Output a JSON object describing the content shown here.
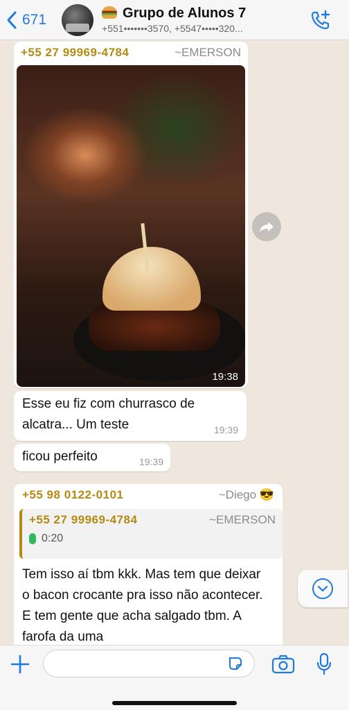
{
  "header": {
    "back_count": "671",
    "title": "Grupo de Alunos 7",
    "subtitle": "+551•••••••3570, +5547•••••320..."
  },
  "messages": {
    "m1": {
      "sender_phone": "+55 27 99969-4784",
      "sender_name": "~EMERSON",
      "photo_time": "19:38"
    },
    "m2": {
      "text": "Esse eu fiz com churrasco de alcatra...  Um teste",
      "time": "19:39"
    },
    "m3": {
      "text": "ficou perfeito",
      "time": "19:39"
    },
    "m4": {
      "sender_phone": "+55 98 0122-0101",
      "sender_name": "~Diego 😎",
      "quote_phone": "+55 27 99969-4784",
      "quote_name": "~EMERSON",
      "quote_audio": "0:20",
      "text": "Tem isso aí tbm kkk. Mas tem que deixar o bacon crocante pra isso não acontecer. E tem gente que acha salgado tbm.  A farofa da uma"
    }
  },
  "input": {
    "value": ""
  },
  "colors": {
    "accent": "#1d7ae0",
    "sender_color": "#b58a12",
    "mic_green": "#2fb85c"
  }
}
